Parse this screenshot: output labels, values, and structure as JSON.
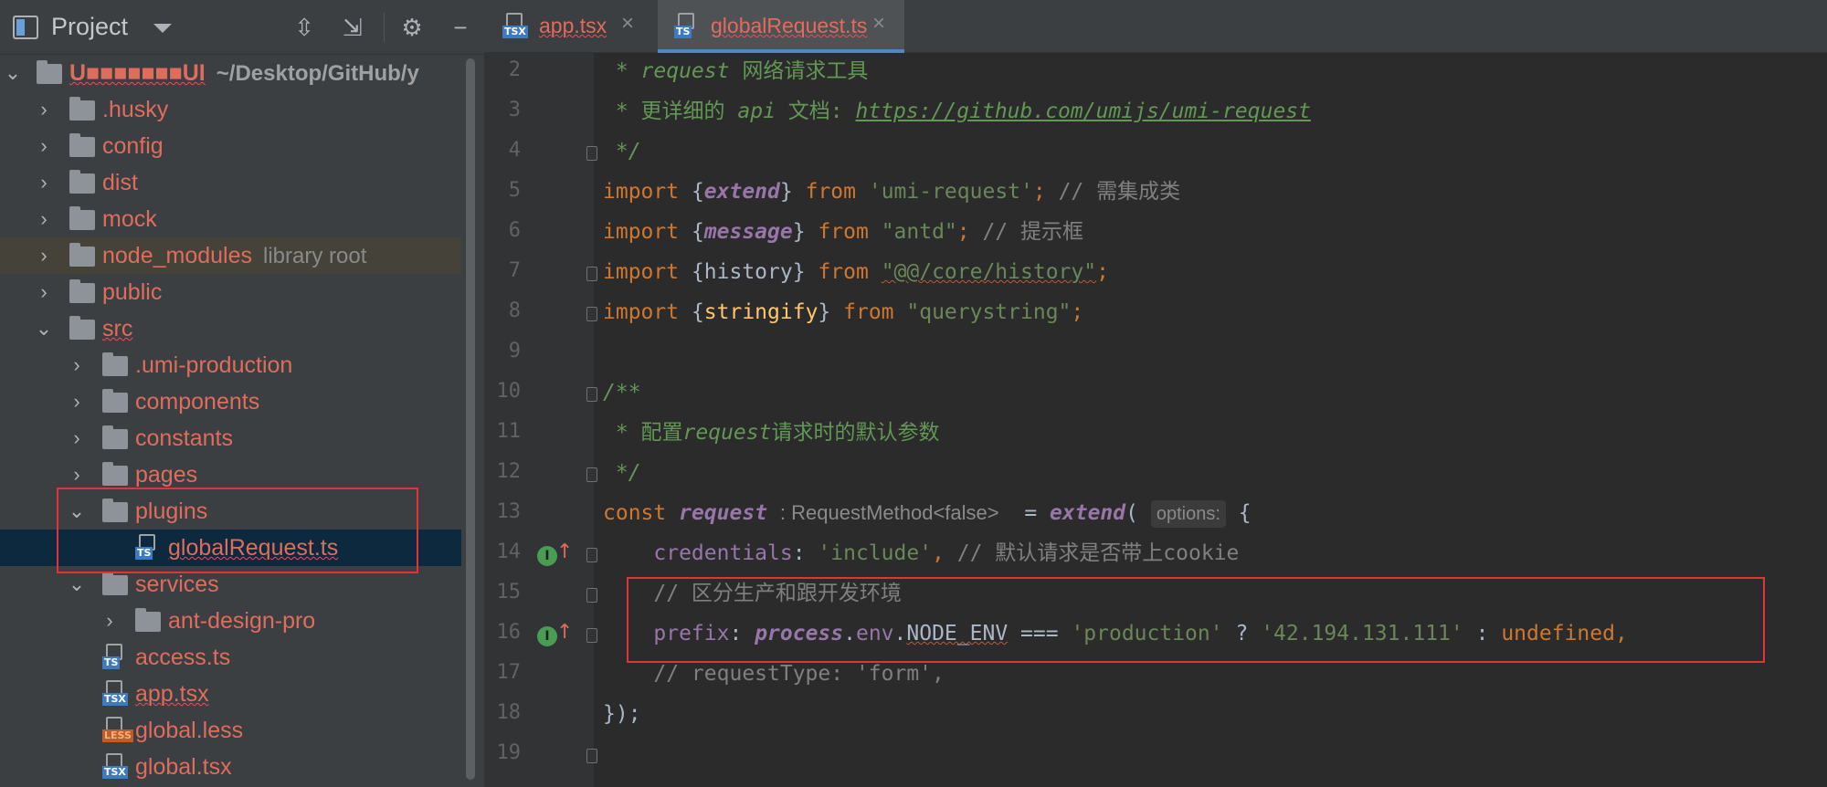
{
  "project_panel": {
    "title": "Project",
    "toolbar": {
      "expand_icon": "expand-all-icon",
      "collapse_icon": "collapse-all-icon",
      "settings_icon": "gear-icon",
      "hide_icon": "minimize-icon"
    },
    "root": {
      "name": "U■■■■■■■UI",
      "path": "~/Desktop/GitHub/y"
    },
    "items": [
      {
        "label": ".husky"
      },
      {
        "label": "config"
      },
      {
        "label": "dist"
      },
      {
        "label": "mock"
      },
      {
        "label": "node_modules",
        "hint": "library root"
      },
      {
        "label": "public"
      },
      {
        "label": "src"
      },
      {
        "label": ".umi-production"
      },
      {
        "label": "components"
      },
      {
        "label": "constants"
      },
      {
        "label": "pages"
      },
      {
        "label": "plugins"
      },
      {
        "label": "globalRequest.ts",
        "type": "TS"
      },
      {
        "label": "services"
      },
      {
        "label": "ant-design-pro"
      },
      {
        "label": "access.ts",
        "type": "TS"
      },
      {
        "label": "app.tsx",
        "type": "TSX"
      },
      {
        "label": "global.less",
        "type": "LESS"
      },
      {
        "label": "global.tsx",
        "type": "TSX"
      }
    ]
  },
  "editor": {
    "tabs": [
      {
        "label": "app.tsx",
        "type": "TSX",
        "active": false
      },
      {
        "label": "globalRequest.ts",
        "type": "TS",
        "active": true
      }
    ],
    "close_glyph": "×",
    "line_numbers": [
      "2",
      "3",
      "4",
      "5",
      "6",
      "7",
      "8",
      "9",
      "10",
      "11",
      "12",
      "13",
      "14",
      "15",
      "16",
      "17",
      "18",
      "19"
    ],
    "code": {
      "l2_star": " * ",
      "l2_a": "request",
      "l2_b": " 网络请求工具",
      "l3_star": " * ",
      "l3_a": "更详细的 ",
      "l3_b": "api",
      "l3_c": " 文档: ",
      "l3_link": "https://github.com/umijs/umi-request",
      "l4": " */",
      "import": "import",
      "from": "from",
      "l5_name": "extend",
      "l5_str": "'umi-request'",
      "l5_cmt": "// 需集成类",
      "l6_name": "message",
      "l6_str": "\"antd\"",
      "l6_cmt": "// 提示框",
      "l7_name": "history",
      "l7_str": "\"@@/core/history\"",
      "l8_name": "stringify",
      "l8_str": "\"querystring\"",
      "l10": "/**",
      "l11_star": " * ",
      "l11_a": "配置",
      "l11_b": "request",
      "l11_c": "请求时的默认参数",
      "l12": " */",
      "l13_kw": "const",
      "l13_name": "request",
      "l13_type": ": RequestMethod<false>",
      "l13_eq": "=",
      "l13_fn": "extend",
      "l13_hint": "options:",
      "l14_key": "credentials",
      "l14_str": "'include'",
      "l14_cmt": "// 默认请求是否带上cookie",
      "l15_cmt": "// 区分生产和跟开发环境",
      "l16_key": "prefix",
      "l16_obj": "process",
      "l16_env": "env",
      "l16_node": "NODE_ENV",
      "l16_op": "===",
      "l16_str1": "'production'",
      "l16_q": "?",
      "l16_str2": "'42.194.131.111'",
      "l16_colon": ":",
      "l16_undef": "undefined",
      "l17_cmt": "// requestType: 'form',",
      "l18": "});"
    }
  }
}
